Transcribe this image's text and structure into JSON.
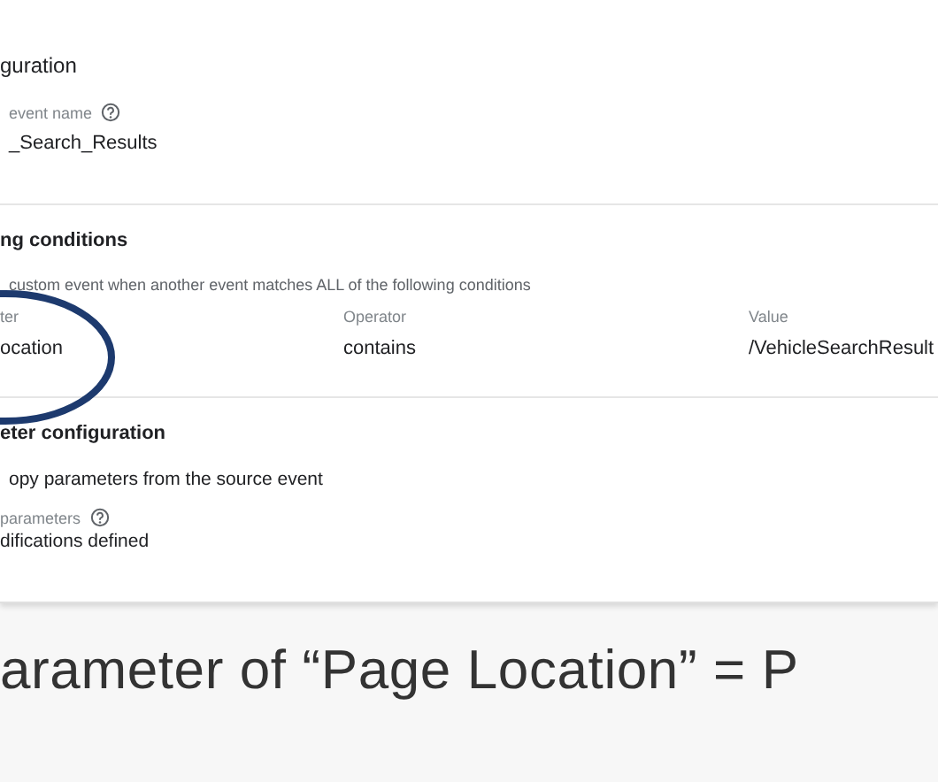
{
  "sections": [
    {
      "title": "guration",
      "fields": [
        {
          "label": "event name",
          "help": true,
          "value": "_Search_Results"
        }
      ]
    },
    {
      "title": "ng conditions",
      "description": "custom event when another event matches ALL of the following conditions",
      "columns": [
        {
          "label": "ter",
          "value": "ocation"
        },
        {
          "label": "Operator",
          "value": "contains"
        },
        {
          "label": "Value",
          "value": "/VehicleSearchResult"
        }
      ]
    },
    {
      "title": "eter configuration",
      "description": "opy parameters from the source event",
      "fields": [
        {
          "label": "parameters",
          "help": true,
          "value": "difications defined"
        }
      ]
    }
  ],
  "caption": "arameter of “Page Location” = P"
}
